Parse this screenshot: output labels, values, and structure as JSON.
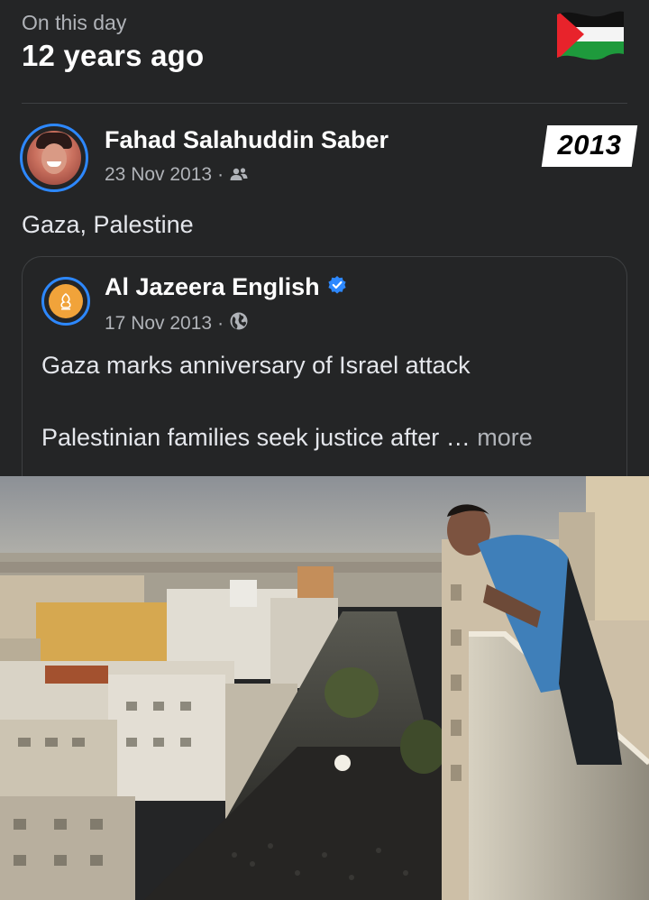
{
  "header": {
    "subtitle": "On this day",
    "title": "12 years ago",
    "flag_icon": "palestine-flag-icon"
  },
  "post": {
    "author": "Fahad Salahuddin Saber",
    "date": "23 Nov 2013",
    "separator": "·",
    "audience_icon": "friends-icon",
    "year_badge": "2013",
    "text": "Gaza, Palestine"
  },
  "shared": {
    "source": "Al Jazeera English",
    "verified_icon": "verified-badge-icon",
    "date": "17 Nov 2013",
    "separator": "·",
    "audience_icon": "globe-icon",
    "headline": "Gaza marks anniversary of Israel attack",
    "description": "Palestinian families seek justice after …",
    "more_label": "more"
  },
  "colors": {
    "background": "#242526",
    "accent": "#2d88ff",
    "secondary_text": "#b0b3b8"
  }
}
